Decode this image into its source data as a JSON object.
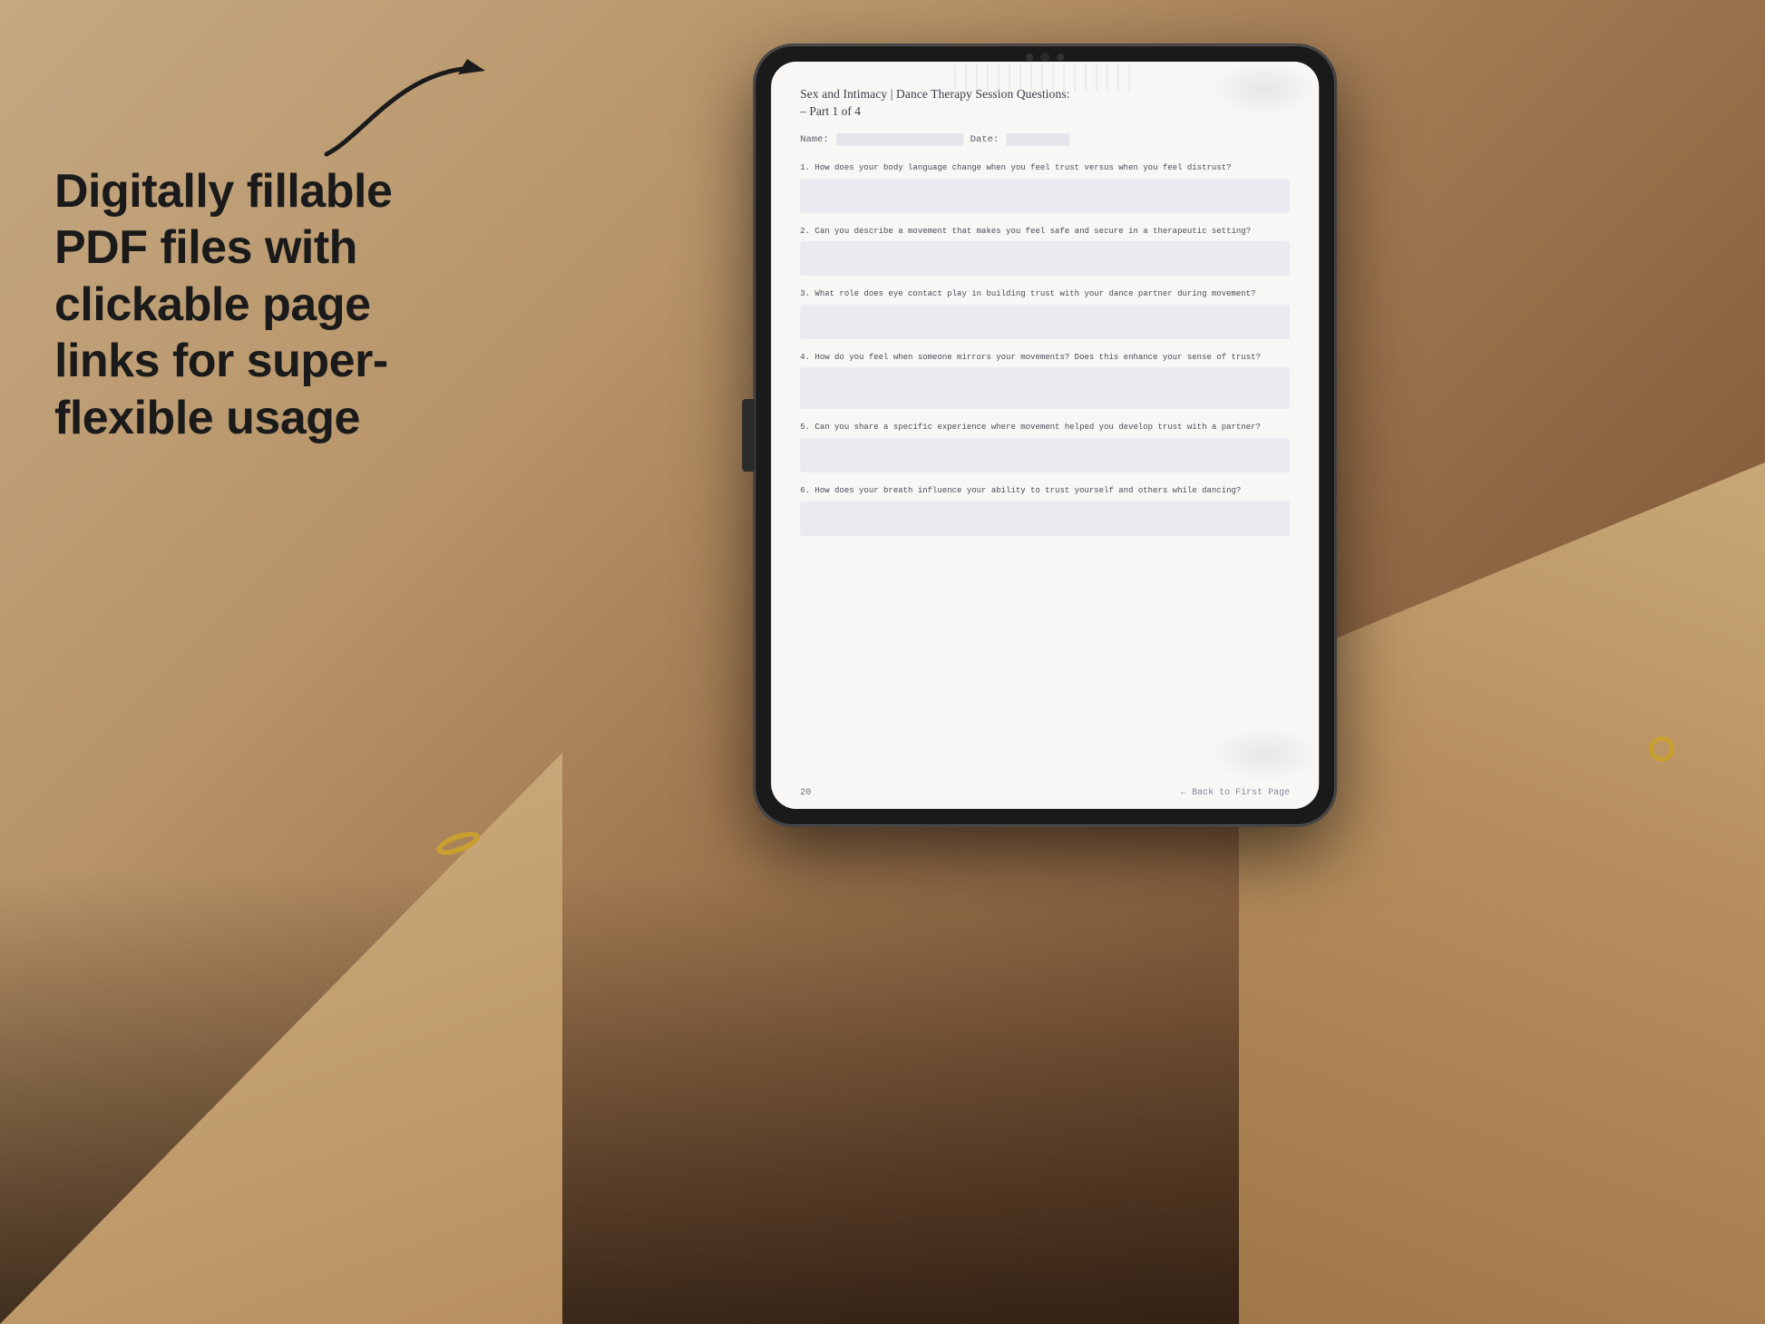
{
  "background": {
    "color_start": "#c4a882",
    "color_end": "#6b4a2a"
  },
  "left_text": {
    "headline": "Digitally fillable PDF files with clickable page links for super-flexible usage"
  },
  "tablet": {
    "pdf": {
      "title": "Sex and Intimacy | Dance Therapy Session Questions:",
      "subtitle": "– Part 1 of 4",
      "name_label": "Name:",
      "date_label": "Date:",
      "questions": [
        {
          "number": "1.",
          "text": "How does your body language change when you feel trust versus when you feel distrust?"
        },
        {
          "number": "2.",
          "text": "Can you describe a movement that makes you feel safe and secure in a therapeutic setting?"
        },
        {
          "number": "3.",
          "text": "What role does eye contact play in building trust with your dance partner during movement?"
        },
        {
          "number": "4.",
          "text": "How do you feel when someone mirrors your movements? Does this enhance your sense of trust?"
        },
        {
          "number": "5.",
          "text": "Can you share a specific experience where movement helped you develop trust with a partner?"
        },
        {
          "number": "6.",
          "text": "How does your breath influence your ability to trust yourself and others while dancing?"
        }
      ],
      "footer": {
        "page_number": "20",
        "back_link": "← Back to First Page"
      }
    }
  }
}
